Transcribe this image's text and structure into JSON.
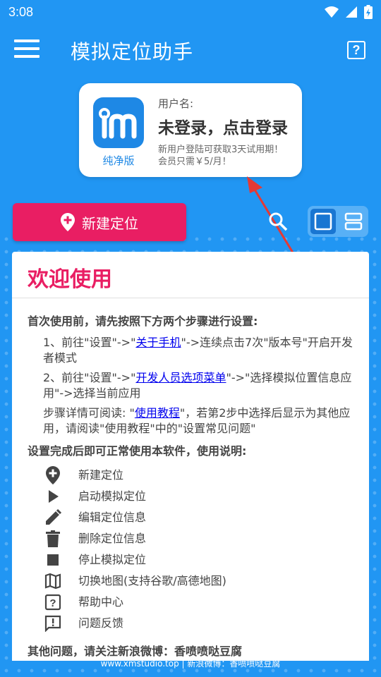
{
  "status": {
    "time": "3:08"
  },
  "app": {
    "title": "模拟定位助手",
    "help_glyph": "?"
  },
  "user_card": {
    "logo_label": "纯净版",
    "user_label": "用户名:",
    "login_text": "未登录，点击登录",
    "trial_text": "新用户登陆可获取3天试用期！会员只需￥5/月！"
  },
  "actions": {
    "new_location_label": "新建定位"
  },
  "colors": {
    "primary": "#2196F3",
    "accent": "#E91E63",
    "link": "#0000EE"
  },
  "welcome": {
    "title": "欢迎使用",
    "setup_heading": "首次使用前，请先按照下方两个步骤进行设置:",
    "step1_pre": "1、前往\"设置\"->\"",
    "step1_link": "关于手机",
    "step1_post": "\"->连续点击7次\"版本号\"开启开发者模式",
    "step2_pre": "2、前往\"设置\"->\"",
    "step2_link": "开发人员选项菜单",
    "step2_post": "\"->\"选择模拟位置信息应用\"->选择当前应用",
    "detail_pre": "步骤详情可阅读: \"",
    "detail_link": "使用教程",
    "detail_post": "\"，若第2步中选择后显示为其他应用，请阅读\"使用教程\"中的\"设置常见问题\"",
    "usage_heading": "设置完成后即可正常使用本软件，使用说明:",
    "functions": [
      {
        "icon": "add-location-icon",
        "label": "新建定位"
      },
      {
        "icon": "play-icon",
        "label": "启动模拟定位"
      },
      {
        "icon": "edit-icon",
        "label": "编辑定位信息"
      },
      {
        "icon": "delete-icon",
        "label": "删除定位信息"
      },
      {
        "icon": "stop-icon",
        "label": "停止模拟定位"
      },
      {
        "icon": "map-icon",
        "label": "切换地图(支持谷歌/高德地图)"
      },
      {
        "icon": "help-icon",
        "label": "帮助中心"
      },
      {
        "icon": "feedback-icon",
        "label": "问题反馈"
      }
    ],
    "other_heading": "其他问题，请关注新浪微博：香喷喷哒豆腐"
  },
  "footer": {
    "text": "www.xmstudio.top | 新浪微博：香喷喷哒豆腐"
  }
}
